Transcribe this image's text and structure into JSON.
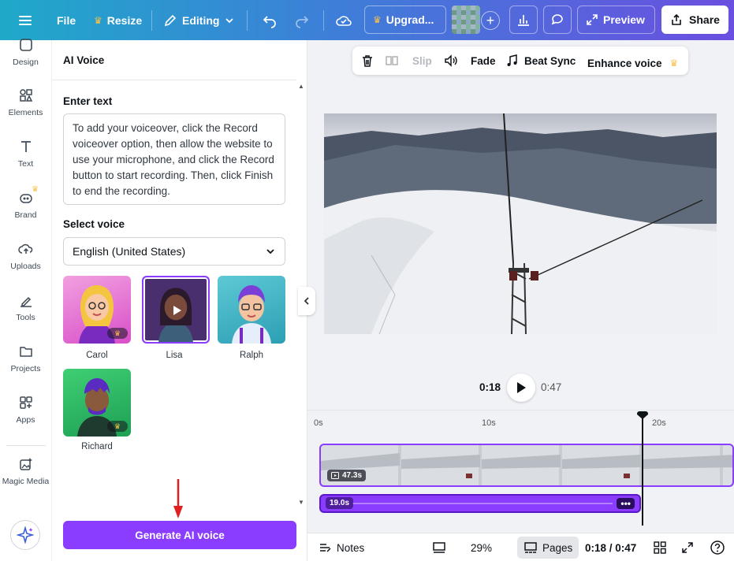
{
  "topbar": {
    "file": "File",
    "resize": "Resize",
    "editing": "Editing",
    "upgrade": "Upgrad...",
    "preview": "Preview",
    "share": "Share",
    "analytics_icon": "bar-chart-icon",
    "comment_icon": "comment-icon"
  },
  "rail": {
    "items": [
      {
        "label": "Design",
        "icon": "design-icon"
      },
      {
        "label": "Elements",
        "icon": "elements-icon"
      },
      {
        "label": "Text",
        "icon": "text-icon"
      },
      {
        "label": "Brand",
        "icon": "brand-icon"
      },
      {
        "label": "Uploads",
        "icon": "upload-icon"
      },
      {
        "label": "Tools",
        "icon": "tools-icon"
      },
      {
        "label": "Projects",
        "icon": "folder-icon"
      },
      {
        "label": "Apps",
        "icon": "apps-icon"
      },
      {
        "label": "Magic Media",
        "icon": "magic-media-icon"
      }
    ]
  },
  "panel": {
    "title": "AI Voice",
    "enter_text_label": "Enter text",
    "text_value": "To add your voiceover, click the Record voiceover option, then allow the website to use your microphone, and click the Record button to start recording. Then, click Finish to end the recording.",
    "select_voice_label": "Select voice",
    "language": "English (United States)",
    "voices": [
      {
        "name": "Carol"
      },
      {
        "name": "Lisa"
      },
      {
        "name": "Ralph"
      },
      {
        "name": "Richard"
      }
    ],
    "generate_button": "Generate AI voice"
  },
  "floating_toolbar": {
    "slip": "Slip",
    "fade": "Fade",
    "beat_sync": "Beat Sync",
    "enhance_voice": "Enhance voice"
  },
  "playback": {
    "current": "0:18",
    "total": "0:47"
  },
  "timeline": {
    "ticks": [
      "0s",
      "10s",
      "20s"
    ],
    "video_duration": "47.3s",
    "audio_duration": "19.0s"
  },
  "bottombar": {
    "notes": "Notes",
    "zoom": "29%",
    "pages": "Pages",
    "time": "0:18 / 0:47"
  },
  "colors": {
    "accent": "#8b3dff",
    "crown": "#f8c04a"
  }
}
